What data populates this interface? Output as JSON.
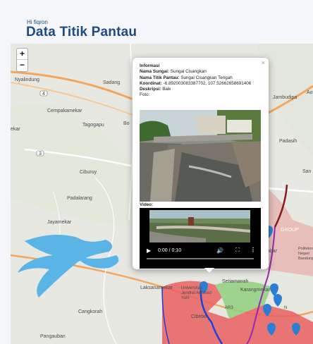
{
  "header": {
    "greeting": "Hi fiqron",
    "title": "Data Titik Pantau"
  },
  "map": {
    "zoom_in": "+",
    "zoom_out": "−",
    "places": {
      "nyalindung": "Nyalindung",
      "sadang": "Sadang",
      "cempakamekar": "Cempakamekar",
      "tagogapu": "Tagogapu",
      "bo": "Bo",
      "ekar": "ekar",
      "ciburuy": "Ciburuy",
      "padalarang": "Padalarang",
      "jayamekar": "Jayamekar",
      "laksanamekar": "Laksanamekar",
      "cangkorah": "Cangkorah",
      "pangauban": "Pangauban",
      "jambudipa": "Jambudipa",
      "padasih": "Padasih",
      "san": "San",
      "setiamanah": "Setiamanah",
      "karangmekar": "Karangmekar",
      "cibeber": "Cibeber",
      "unjani": "Universitas Jendral Achmad Yani",
      "politeknik": "Politeknik Negeri Bandung",
      "sabar": "abar",
      "group": "GROUP",
      "ao": "Ao",
      "road_4": "4",
      "road_3": "3",
      "road_n": "N",
      "ar3": "AR3"
    },
    "colors": {
      "background": "#e8e9e4",
      "reservoir": "#5ab4e6",
      "road_major": "#f4a65d",
      "region_red": "#e86060",
      "region_green": "#8fcf7c",
      "river_blue": "#1e3fd8",
      "river_purple": "#9b27b0",
      "river_maroon": "#8b1a1a",
      "marker": "#2a7fd4"
    }
  },
  "popup": {
    "close": "×",
    "heading": "Informasi",
    "sungai_label": "Nama Sungai:",
    "sungai_value": "Sungai Cisangkan",
    "titik_label": "Nama Titik Pantau:",
    "titik_value": "Sungai Cisangkan Tengah",
    "koordinat_label": "Koordinat:",
    "koordinat_value": "-6.892003083387702, 107.52662658691406",
    "deskripsi_label": "Deskripsi:",
    "deskripsi_value": "Baik",
    "foto_label": "Foto:",
    "video_label": "Video:",
    "video_time": "0:00 / 0:10"
  }
}
